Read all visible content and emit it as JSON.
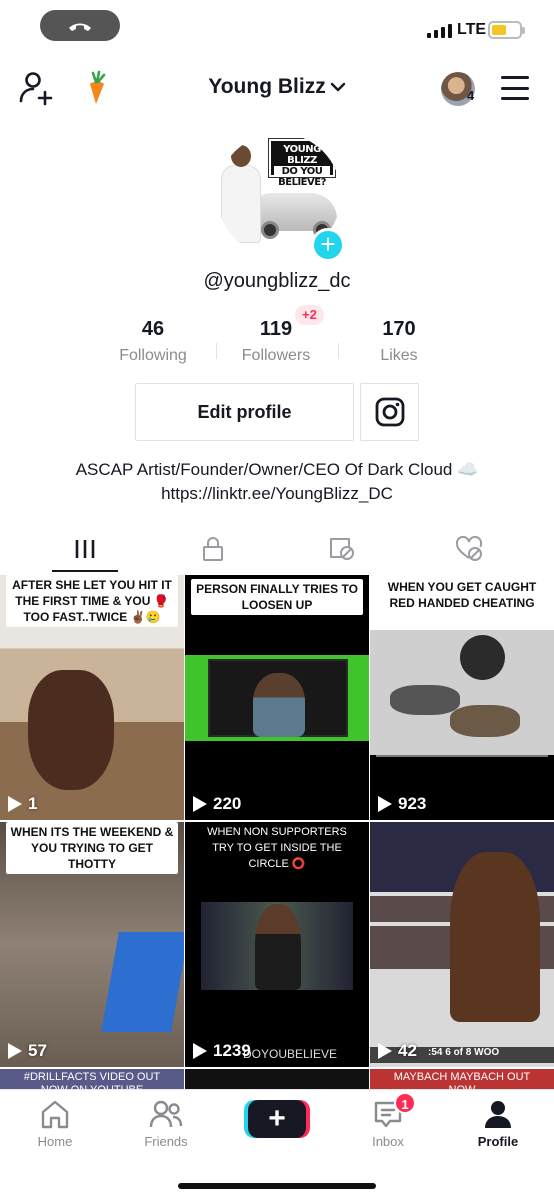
{
  "status_bar": {
    "network": "LTE",
    "battery_color": "#f3c623"
  },
  "header": {
    "title": "Young Blizz",
    "friend_count": "4"
  },
  "profile": {
    "handle": "@youngblizz_dc",
    "avatar_sign_lines": [
      "YOUNG BLIZZ",
      "DO YOU",
      "BELIEVE?"
    ],
    "stats": [
      {
        "value": "46",
        "label": "Following"
      },
      {
        "value": "119",
        "label": "Followers"
      },
      {
        "value": "170",
        "label": "Likes"
      }
    ],
    "followers_delta": "+2",
    "edit_button": "Edit profile",
    "bio_line1": "ASCAP Artist/Founder/Owner/CEO Of Dark Cloud ☁️",
    "bio_line2": "https://linktr.ee/YoungBlizz_DC"
  },
  "tabs": [
    "videos-grid",
    "private",
    "reposts-hidden",
    "liked-hidden"
  ],
  "videos": [
    {
      "caption": "AFTER SHE LET YOU HIT IT THE FIRST TIME & YOU 🥊 TOO FAST..TWICE ✌🏾🥲",
      "views": "1"
    },
    {
      "caption": "PERSON FINALLY TRIES TO LOOSEN UP",
      "views": "220"
    },
    {
      "caption": "WHEN YOU GET CAUGHT RED HANDED CHEATING",
      "views": "923"
    },
    {
      "caption": "WHEN ITS THE WEEKEND & YOU TRYING TO GET THOTTY",
      "views": "57"
    },
    {
      "caption": "WHEN NON SUPPORTERS TRY TO GET INSIDE THE CIRCLE ⭕",
      "views": "1239",
      "overlay": "DOYOUBELIEVE"
    },
    {
      "caption": "",
      "views": "42",
      "overlay": ":54   6 of 8   WOO"
    },
    {
      "caption": "#DRILLFACTS VIDEO OUT NOW ON YOUTUBE",
      "views": ""
    },
    {
      "caption": "",
      "views": ""
    },
    {
      "caption": "MAYBACH MAYBACH OUT NOW",
      "views": ""
    }
  ],
  "bottom_nav": {
    "home": "Home",
    "friends": "Friends",
    "inbox": "Inbox",
    "inbox_badge": "1",
    "profile": "Profile"
  },
  "colors": {
    "accent_pink": "#fe2c55",
    "accent_cyan": "#20d5ec",
    "text": "#161823",
    "muted": "#8a8b91"
  }
}
